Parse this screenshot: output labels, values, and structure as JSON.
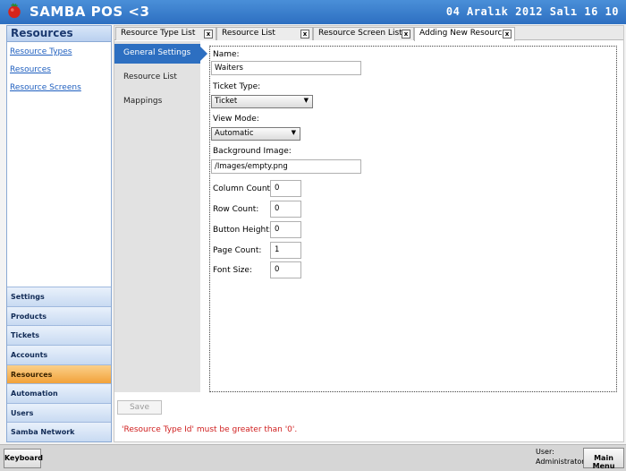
{
  "app": {
    "title": "SAMBA POS <3",
    "clock": "04 Aralık 2012 Salı 16 10",
    "logo_icon": "tomato-logo-icon"
  },
  "sidebar": {
    "header": "Resources",
    "links": [
      "Resource Types",
      "Resources",
      "Resource Screens"
    ],
    "nav": [
      {
        "label": "Settings",
        "active": false
      },
      {
        "label": "Products",
        "active": false
      },
      {
        "label": "Tickets",
        "active": false
      },
      {
        "label": "Accounts",
        "active": false
      },
      {
        "label": "Resources",
        "active": true
      },
      {
        "label": "Automation",
        "active": false
      },
      {
        "label": "Users",
        "active": false
      },
      {
        "label": "Samba Network",
        "active": false
      }
    ]
  },
  "tabs": [
    {
      "label": "Resource Type List",
      "active": false
    },
    {
      "label": "Resource List",
      "active": false
    },
    {
      "label": "Resource Screen List",
      "active": false
    },
    {
      "label": "Adding New Resource",
      "active": true
    }
  ],
  "tab_close_glyph": "x",
  "subtabs": [
    "General Settings",
    "Resource List",
    "Mappings"
  ],
  "form": {
    "name_label": "Name:",
    "name_value": "Waiters",
    "ticket_type_label": "Ticket Type:",
    "ticket_type_value": "Ticket",
    "view_mode_label": "View Mode:",
    "view_mode_value": "Automatic",
    "background_label": "Background Image:",
    "background_value": "/Images/empty.png",
    "column_count_label": "Column Count:",
    "column_count_value": "0",
    "row_count_label": "Row Count:",
    "row_count_value": "0",
    "button_height_label": "Button Height:",
    "button_height_value": "0",
    "page_count_label": "Page Count:",
    "page_count_value": "1",
    "font_size_label": "Font Size:",
    "font_size_value": "0"
  },
  "save_label": "Save",
  "error_message": "'Resource Type Id' must be greater than '0'.",
  "bottom": {
    "keyboard_label": "Keyboard",
    "user_label": "User:",
    "user_name": "Administrator",
    "main_menu_label": "Main Menu"
  },
  "colors": {
    "title_bar": "#2d6fc1",
    "active_nav": "#f2a23a",
    "active_subtab": "#2d6fc1",
    "error": "#d02020"
  }
}
